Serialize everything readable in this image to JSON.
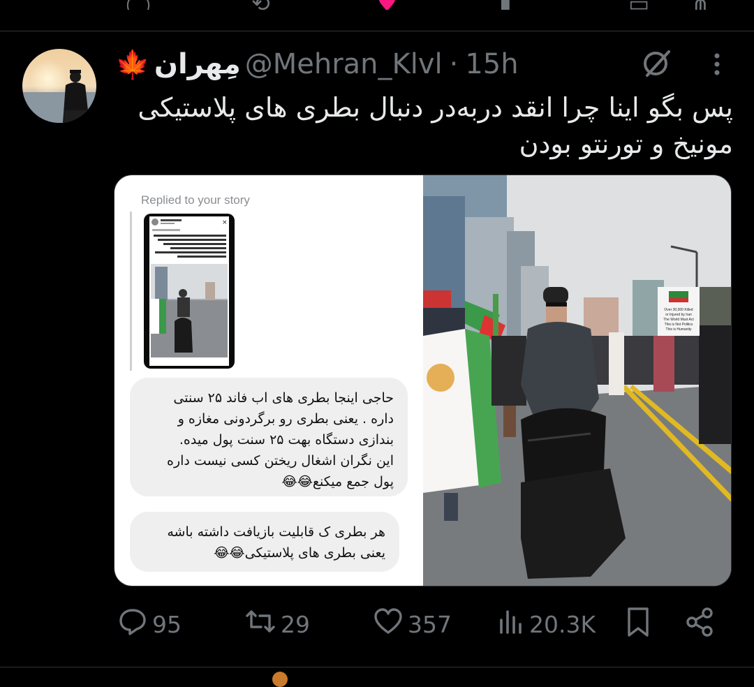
{
  "tweet": {
    "display_name": "مِهران",
    "name_emoji": "🍁",
    "handle": "@Mehran_Klvl",
    "separator": "·",
    "time": "15h",
    "text_line1": "پس بگو اینا چرا انقد دربه‌در دنبال بطری های پلاستیکی",
    "text_line2": "مونیخ و تورنتو بودن"
  },
  "media": {
    "story_header": "Replied to your story",
    "bubble1_lines": [
      "حاجی اینجا بطری های اب فاند ۲۵ سنتی",
      "داره . یعنی بطری رو برگردونی مغازه و",
      "بندازی دستگاه بهت ۲۵ سنت پول میده.",
      "این نگران اشغال ریختن کسی نیست داره",
      "پول جمع میکنع😂😂"
    ],
    "bubble2_lines": [
      "هر بطری ک قابلیت بازیافت داشته باشه",
      "یعنی بطری های پلاستیکی😂😂"
    ],
    "sign_lines": [
      "Over 30,000 Killed",
      "or Injured by Iran",
      "The World Must Act",
      "This is Not Politics",
      "This is Humanity"
    ]
  },
  "actions": {
    "replies": "95",
    "reposts": "29",
    "likes": "357",
    "views": "20.3K"
  },
  "colors": {
    "background": "#000000",
    "text": "#e7e9ea",
    "muted": "#71767b",
    "divider": "#2f3336",
    "like_pink": "#f91880"
  },
  "icons": [
    "reply-icon",
    "repost-icon",
    "like-icon",
    "views-icon",
    "bookmark-icon",
    "share-icon",
    "grok-icon",
    "more-icon"
  ]
}
